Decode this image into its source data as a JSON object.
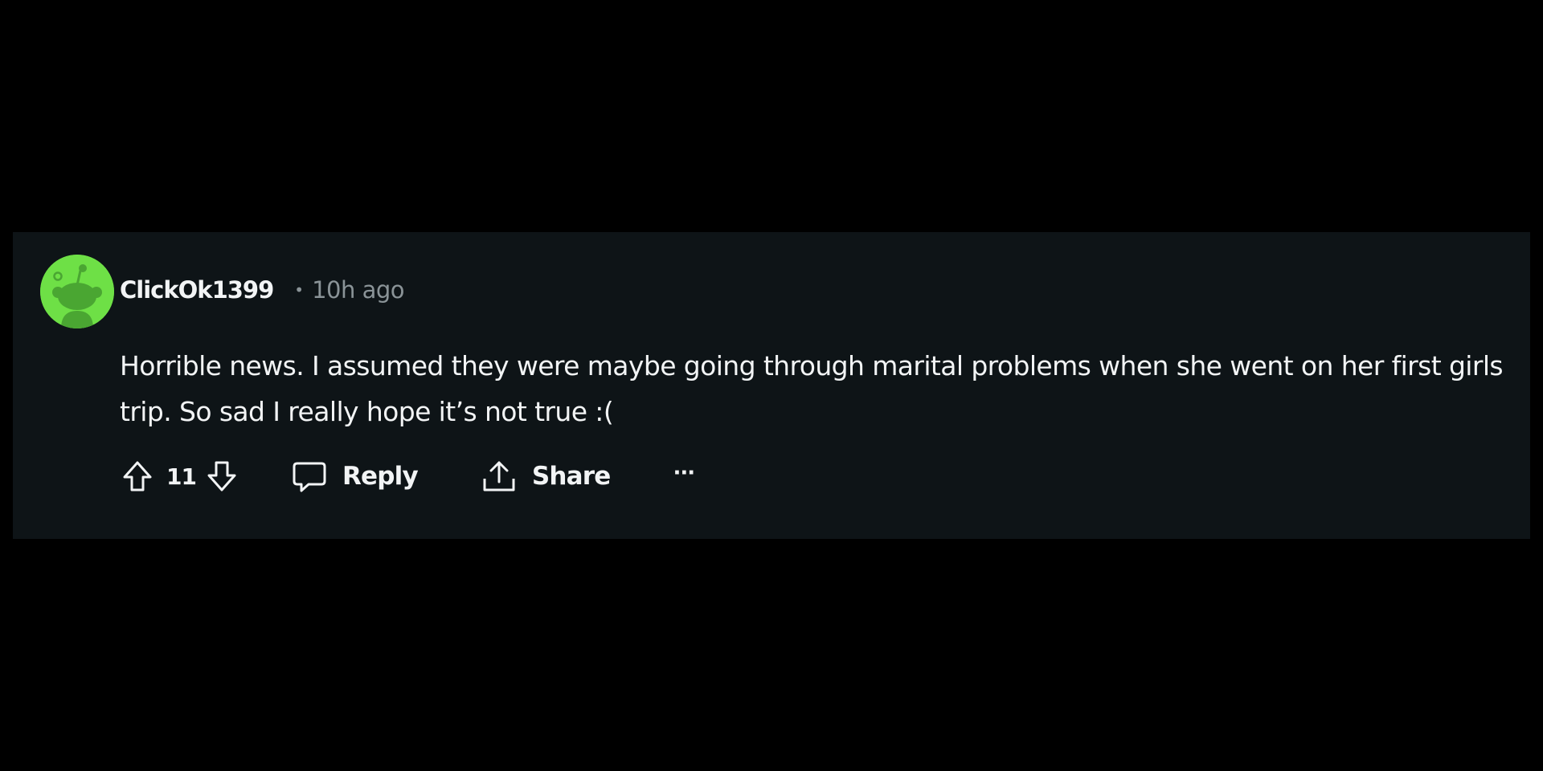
{
  "comment": {
    "author": "ClickOk1399",
    "separator": "•",
    "timestamp": "10h ago",
    "body": "Horrible news. I assumed they were maybe going through marital problems when she went on her first girls trip. So sad I really hope it’s not true :(",
    "vote_count": "11",
    "avatar_color": "#6EE046"
  },
  "actions": {
    "upvote_icon": "arrow-up-icon",
    "downvote_icon": "arrow-down-icon",
    "reply_icon": "speech-bubble-icon",
    "reply_label": "Reply",
    "share_icon": "share-upload-icon",
    "share_label": "Share",
    "more_label": "···"
  },
  "theme": {
    "background": "#000000",
    "card_background": "#0E1417",
    "text_primary": "#F2F4F5",
    "text_secondary": "#8A9397"
  }
}
